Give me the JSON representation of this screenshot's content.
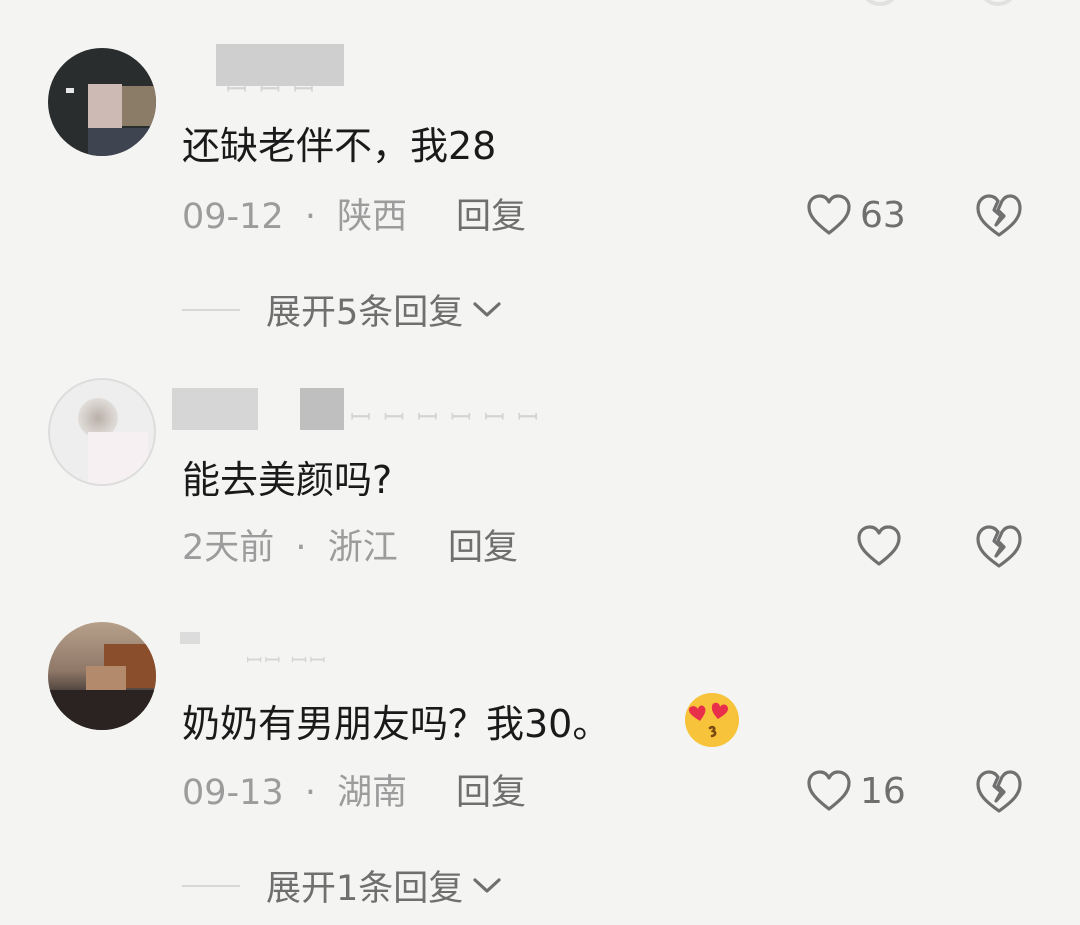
{
  "colors": {
    "background": "#f4f4f3",
    "text": "#1a1a1a",
    "meta": "#9c9c9c",
    "action": "#6f6f6f"
  },
  "comments": [
    {
      "text": "还缺老伴不，我28",
      "date": "09-12",
      "location": "陕西",
      "reply_label": "回复",
      "like_count": "63",
      "expand_label": "展开5条回复"
    },
    {
      "text": "能去美颜吗?",
      "date": "2天前",
      "location": "浙江",
      "reply_label": "回复",
      "like_count": "",
      "expand_label": ""
    },
    {
      "text": "奶奶有男朋友吗？我30。",
      "emoji": "kissing-heart-eyes-emoji",
      "date": "09-13",
      "location": "湖南",
      "reply_label": "回复",
      "like_count": "16",
      "expand_label": "展开1条回复"
    }
  ],
  "separator": "·",
  "icons": {
    "like": "heart-outline-icon",
    "dislike": "broken-heart-icon",
    "expand": "chevron-down-icon"
  }
}
